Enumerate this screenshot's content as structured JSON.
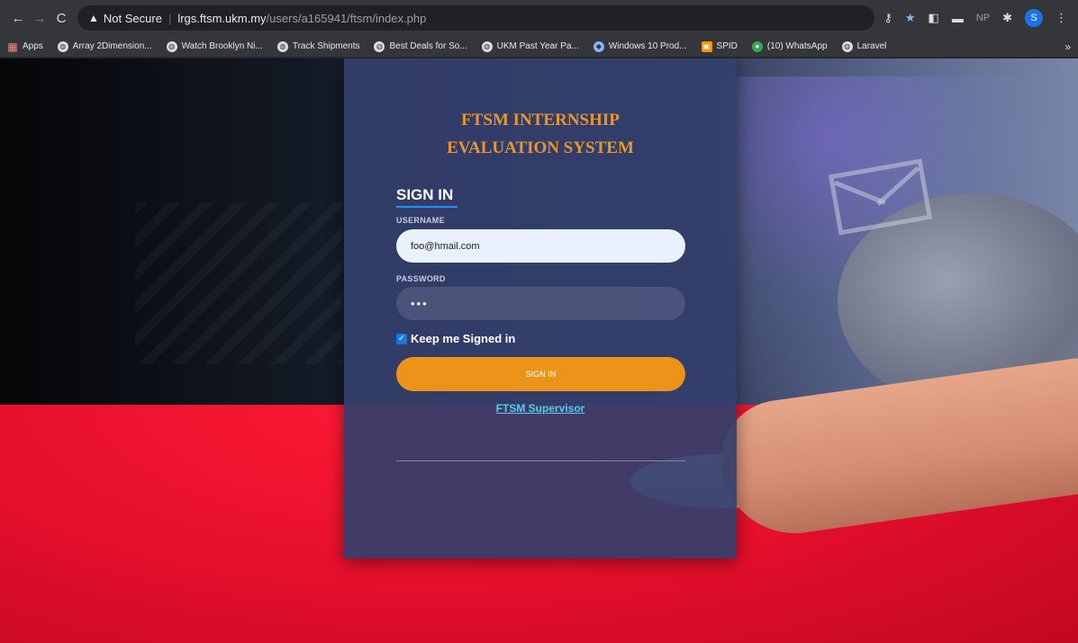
{
  "browser": {
    "url_warning": "Not Secure",
    "url_host": "lrgs.ftsm.ukm.my",
    "url_path": "/users/a165941/ftsm/index.php",
    "profile_initial": "S",
    "extension_np": "NP",
    "bookmarks": [
      {
        "label": "Apps",
        "icon": "apps-grid-icon"
      },
      {
        "label": "Array 2Dimension...",
        "icon": "globe-icon"
      },
      {
        "label": "Watch Brooklyn Ni...",
        "icon": "globe-icon"
      },
      {
        "label": "Track Shipments",
        "icon": "globe-icon"
      },
      {
        "label": "Best Deals for So...",
        "icon": "globe-icon"
      },
      {
        "label": "UKM Past Year Pa...",
        "icon": "globe-icon"
      },
      {
        "label": "Windows 10 Prod...",
        "icon": "windows-icon"
      },
      {
        "label": "SPID",
        "icon": "spid-icon"
      },
      {
        "label": "(10) WhatsApp",
        "icon": "whatsapp-icon"
      },
      {
        "label": "Laravel",
        "icon": "globe-icon"
      }
    ],
    "bookmarks_more": "»"
  },
  "login": {
    "title_line1": "FTSM INTERNSHIP",
    "title_line2": "EVALUATION SYSTEM",
    "tab_label": "SIGN IN",
    "username_label": "USERNAME",
    "username_value": "foo@hmail.com",
    "password_label": "PASSWORD",
    "password_value": "•••",
    "keep_signed_in": "Keep me Signed in",
    "keep_signed_in_checked": true,
    "signin_button": "SIGN IN",
    "supervisor_link": "FTSM Supervisor"
  },
  "colors": {
    "panel": "#343e6c",
    "title": "#e6962d",
    "button": "#ec9319",
    "link": "#4fd0f0",
    "background_red": "#e8102c"
  }
}
